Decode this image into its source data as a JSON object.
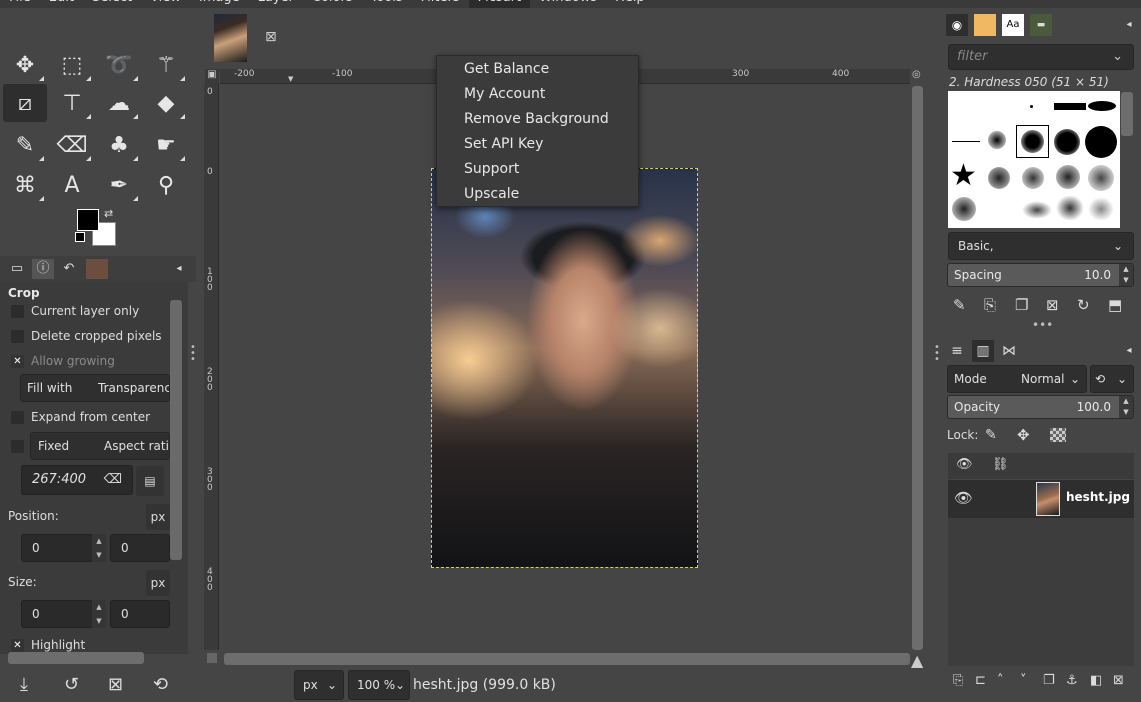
{
  "menubar": {
    "items": [
      "File",
      "Edit",
      "Select",
      "View",
      "Image",
      "Layer",
      "Colors",
      "Tools",
      "Filters",
      "Picsart",
      "Windows",
      "Help"
    ],
    "active": "Picsart"
  },
  "toolbox": {
    "tools": [
      "move-tool",
      "rect-select-tool",
      "free-select-tool",
      "fuzzy-select-tool",
      "crop-tool",
      "transform-tool",
      "warp-tool",
      "bucket-fill-tool",
      "paintbrush-tool",
      "eraser-tool",
      "clone-tool",
      "smudge-tool",
      "paths-tool",
      "text-tool",
      "color-picker-tool",
      "zoom-tool"
    ],
    "selected_tool": "crop-tool"
  },
  "tool_options": {
    "title": "Crop",
    "current_layer_only": "Current layer only",
    "delete_cropped_pixels": "Delete cropped pixels",
    "allow_growing": "Allow growing",
    "fill_with_label": "Fill with",
    "fill_with_value": "Transparency",
    "expand_from_center": "Expand from center",
    "fixed_label": "Fixed",
    "fixed_value": "Aspect ratio",
    "ratio_value": "267:400",
    "position_label": "Position:",
    "position_unit": "px",
    "position_x": "0",
    "position_y": "0",
    "size_label": "Size:",
    "size_unit": "px",
    "size_w": "0",
    "size_h": "0",
    "highlight": "Highlight"
  },
  "image_window": {
    "ruler_top_labels": [
      "-200",
      "-100",
      "300",
      "400"
    ],
    "ruler_left_labels": [
      "0",
      "0",
      "1 0 0",
      "2 0 0",
      "3 0 0",
      "4 0 0"
    ],
    "status_unit": "px",
    "zoom": "100 %",
    "file_info": "hesht.jpg (999.0 kB)"
  },
  "picsart_menu": {
    "items": [
      "Get Balance",
      "My Account",
      "Remove Background",
      "Set API Key",
      "Support",
      "Upscale"
    ]
  },
  "brushes_panel": {
    "filter_placeholder": "filter",
    "brush_name": "2. Hardness 050 (51 × 51)",
    "preset": "Basic,",
    "spacing_label": "Spacing",
    "spacing_value": "10.0"
  },
  "layers_panel": {
    "mode_label": "Mode",
    "mode_value": "Normal",
    "opacity_label": "Opacity",
    "opacity_value": "100.0",
    "lock_label": "Lock:",
    "layer_name": "hesht.jpg"
  },
  "colors": {
    "fg": "#000000",
    "bg": "#ffffff",
    "selection_marquee": "#e3e100"
  }
}
